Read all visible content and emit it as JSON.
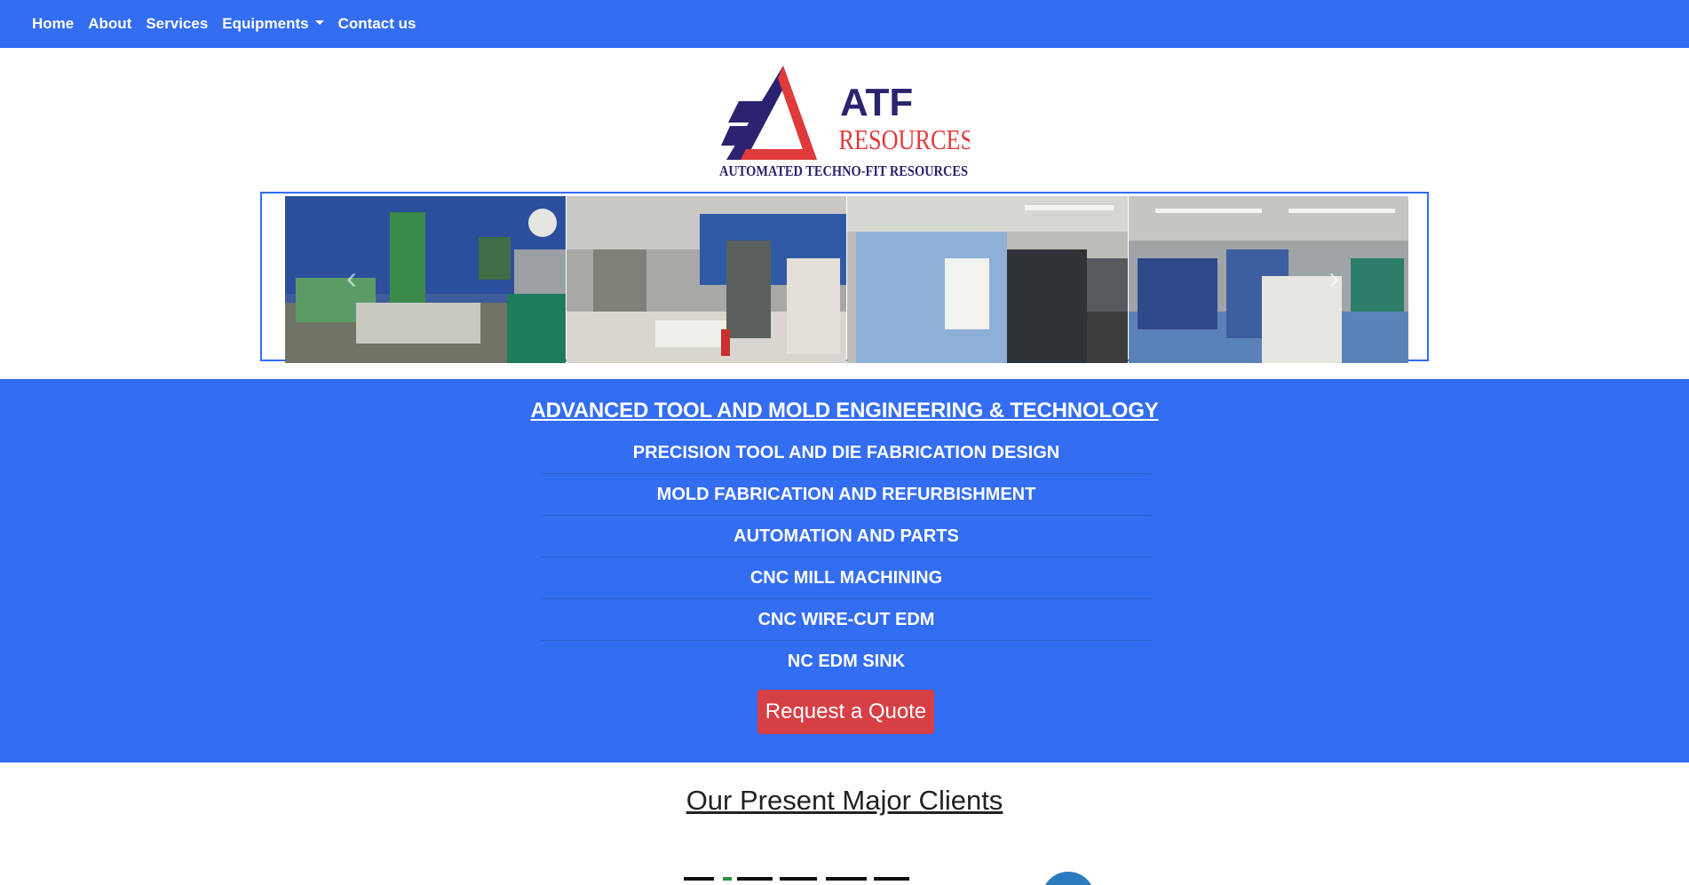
{
  "nav": {
    "home": "Home",
    "about": "About",
    "services": "Services",
    "equipments": "Equipments",
    "contact": "Contact us"
  },
  "logo": {
    "brand_top": "ATF",
    "brand_bottom": "RESOURCES",
    "tagline": "AUTOMATED TECHNO-FIT RESOURCES"
  },
  "carousel": {
    "prev_icon": "chevron-left-icon",
    "next_icon": "chevron-right-icon"
  },
  "services": {
    "title": "ADVANCED TOOL AND MOLD ENGINEERING & TECHNOLOGY",
    "items": [
      "PRECISION TOOL AND DIE FABRICATION DESIGN",
      "MOLD FABRICATION AND REFURBISHMENT",
      "AUTOMATION AND PARTS",
      "CNC MILL MACHINING",
      "CNC WIRE-CUT EDM",
      "NC EDM SINK"
    ],
    "quote_button": "Request a Quote"
  },
  "clients": {
    "title": "Our Present Major Clients"
  },
  "colors": {
    "primary": "#336df2",
    "accent": "#d64045",
    "logo_navy": "#2a2470",
    "logo_red": "#e03a3a"
  }
}
